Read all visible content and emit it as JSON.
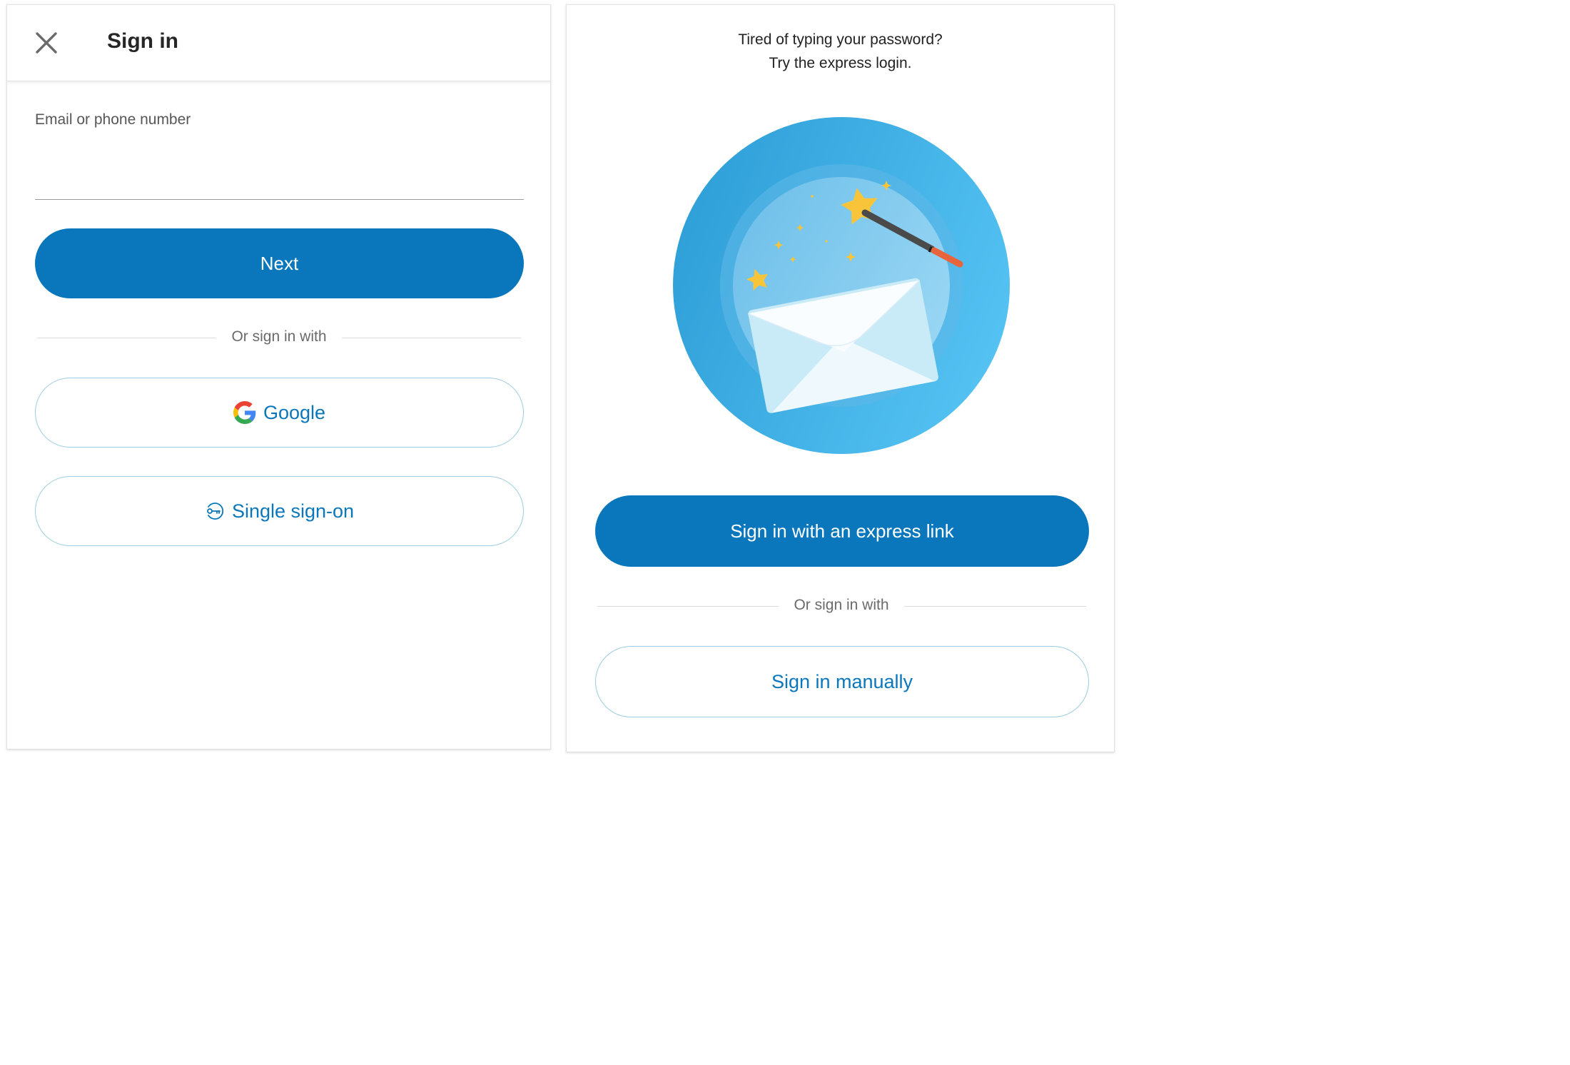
{
  "left_panel": {
    "title": "Sign in",
    "email_label": "Email or phone number",
    "email_value": "",
    "next_label": "Next",
    "divider": "Or sign in with",
    "google_label": "Google",
    "sso_label": "Single sign-on"
  },
  "right_panel": {
    "tagline_line1": "Tired of typing your password?",
    "tagline_line2": "Try the express login.",
    "express_label": "Sign in with an express link",
    "divider": "Or sign in with",
    "manual_label": "Sign in manually"
  },
  "icons": [
    "close-icon",
    "google-icon",
    "key-icon",
    "envelope-icon",
    "magic-wand-icon",
    "star-icon"
  ],
  "colors": {
    "primary": "#0a77bc",
    "outline_border": "#9bcde0",
    "circle_blue": "#3aaee6",
    "star_yellow": "#f8c53a",
    "wand_tip": "#e8643c"
  }
}
